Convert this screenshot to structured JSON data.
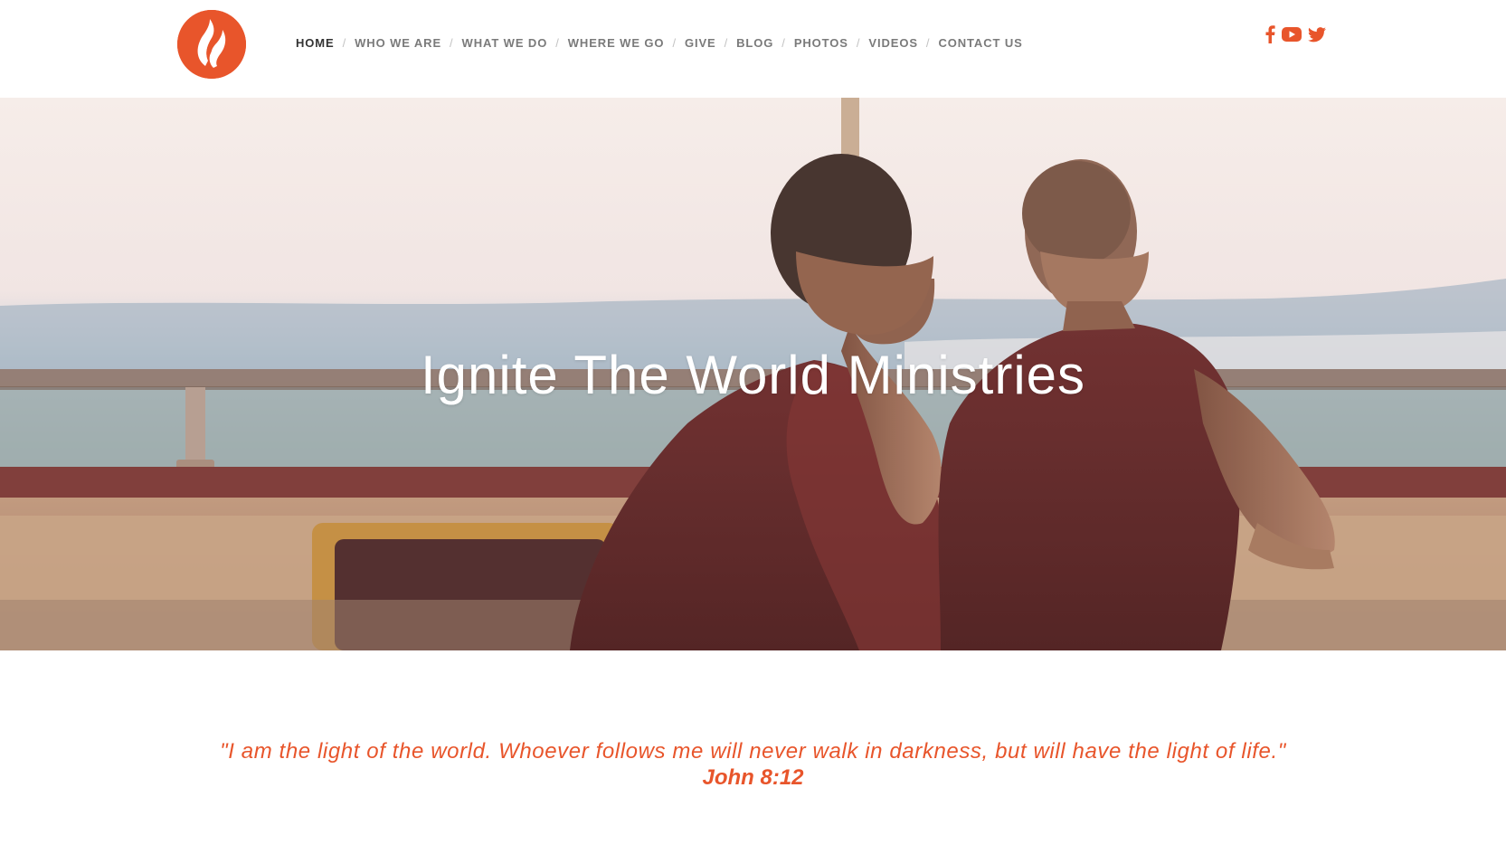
{
  "colors": {
    "accent": "#e8552b",
    "nav_text": "#7a7a7a",
    "nav_active": "#333333"
  },
  "header": {
    "logo_icon": "flame-logo-icon",
    "nav": [
      {
        "label": "HOME",
        "active": true
      },
      {
        "label": "WHO WE ARE",
        "active": false
      },
      {
        "label": "WHAT WE DO",
        "active": false
      },
      {
        "label": "WHERE WE GO",
        "active": false
      },
      {
        "label": "GIVE",
        "active": false
      },
      {
        "label": "BLOG",
        "active": false
      },
      {
        "label": "PHOTOS",
        "active": false
      },
      {
        "label": "VIDEOS",
        "active": false
      },
      {
        "label": "CONTACT US",
        "active": false
      }
    ],
    "separator": "/",
    "social": [
      {
        "icon": "facebook-icon"
      },
      {
        "icon": "youtube-icon"
      },
      {
        "icon": "twitter-icon"
      }
    ]
  },
  "hero": {
    "title": "Ignite The World Ministries"
  },
  "quote": {
    "text": "\"I am the light of the world. Whoever follows me will never walk in darkness, but will have the light of life.\"",
    "reference": "John 8:12"
  }
}
